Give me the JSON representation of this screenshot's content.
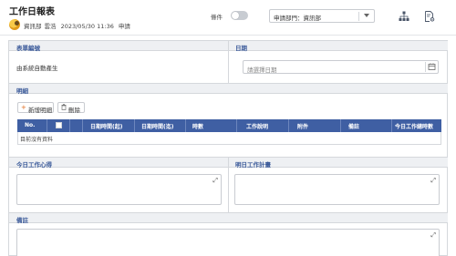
{
  "header": {
    "title": "工作日報表",
    "user_dept": "資訊部",
    "user_name": "雲浩",
    "datetime": "2023/05/30 11:36",
    "status": "申請"
  },
  "toolbar": {
    "toggle_label": "條件",
    "toggle_on": false,
    "dept_select_value": "申請部門：資訊部",
    "org_icon": "org-chart-icon",
    "doc_icon": "document-settings-icon"
  },
  "form": {
    "form_no_label": "表單編號",
    "form_no_value": "由系統自動產生",
    "date_label": "日期",
    "date_placeholder": "請選擇日期",
    "detail_label": "明細",
    "add_detail_button": "新增明細",
    "delete_button": "刪除",
    "grid": {
      "columns": [
        "No.",
        "",
        "日期時間(起)",
        "日期時間(迄)",
        "時數",
        "工作說明",
        "附件",
        "備註",
        "今日工作總時數"
      ],
      "empty_text": "目前沒有資料"
    },
    "today_thoughts_label": "今日工作心得",
    "tomorrow_plan_label": "明日工作計畫",
    "remarks_label": "備註"
  }
}
